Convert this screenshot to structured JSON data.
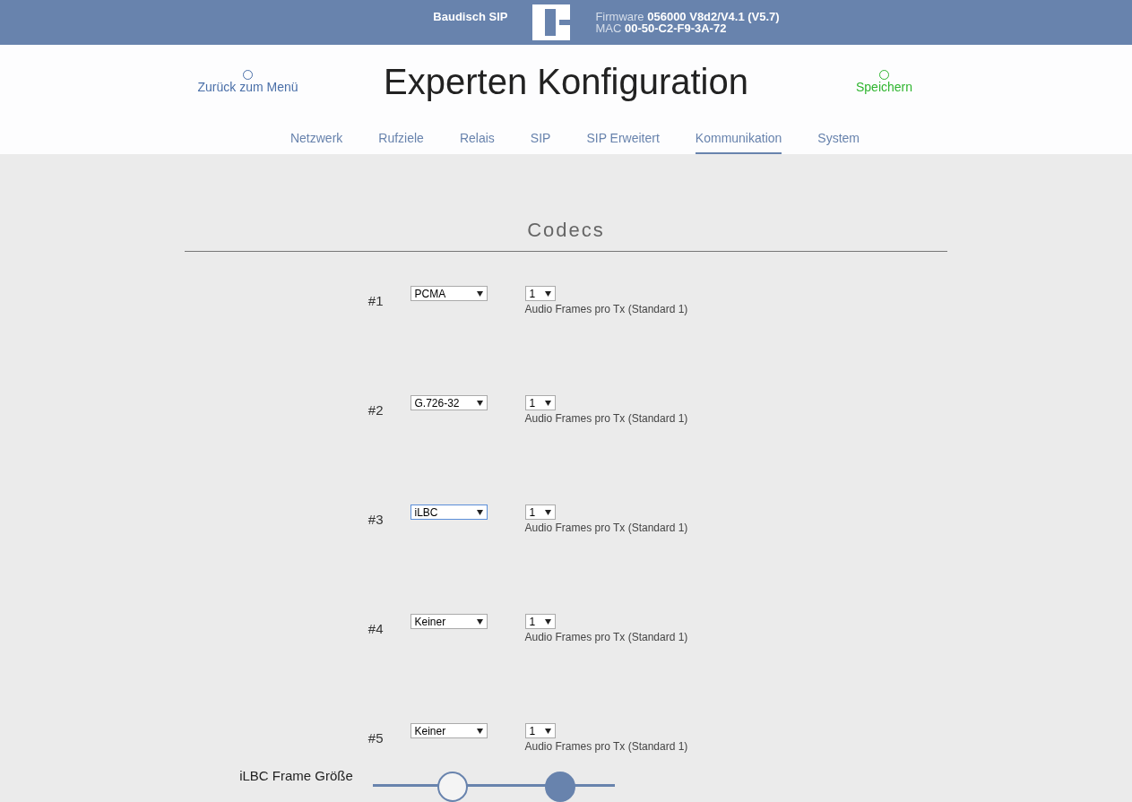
{
  "header": {
    "product": "Baudisch SIP",
    "firmware_label": "Firmware",
    "firmware": "056000 V8d2/V4.1 (V5.7)",
    "mac_label": "MAC",
    "mac": "00-50-C2-F9-3A-72"
  },
  "back_link": "Zurück zum Menü",
  "title": "Experten Konfiguration",
  "save_link": "Speichern",
  "tabs": [
    {
      "label": "Netzwerk",
      "selected": false
    },
    {
      "label": "Rufziele",
      "selected": false
    },
    {
      "label": "Relais",
      "selected": false
    },
    {
      "label": "SIP",
      "selected": false
    },
    {
      "label": "SIP Erweitert",
      "selected": false
    },
    {
      "label": "Kommunikation",
      "selected": true
    },
    {
      "label": "System",
      "selected": false
    }
  ],
  "section_title": "Codecs",
  "codecs": [
    {
      "label": "#1",
      "codec": "PCMA",
      "focused": false,
      "frames": "1",
      "hint": "Audio Frames pro Tx (Standard 1)"
    },
    {
      "label": "#2",
      "codec": "G.726-32",
      "focused": false,
      "frames": "1",
      "hint": "Audio Frames pro Tx (Standard 1)"
    },
    {
      "label": "#3",
      "codec": "iLBC",
      "focused": true,
      "frames": "1",
      "hint": "Audio Frames pro Tx (Standard 1)"
    },
    {
      "label": "#4",
      "codec": "Keiner",
      "focused": false,
      "frames": "1",
      "hint": "Audio Frames pro Tx (Standard 1)"
    },
    {
      "label": "#5",
      "codec": "Keiner",
      "focused": false,
      "frames": "1",
      "hint": "Audio Frames pro Tx (Standard 1)"
    }
  ],
  "ilbc_frame": {
    "label": "iLBC Frame Größe",
    "positions": [
      {
        "selected": false
      },
      {
        "selected": true
      }
    ]
  }
}
